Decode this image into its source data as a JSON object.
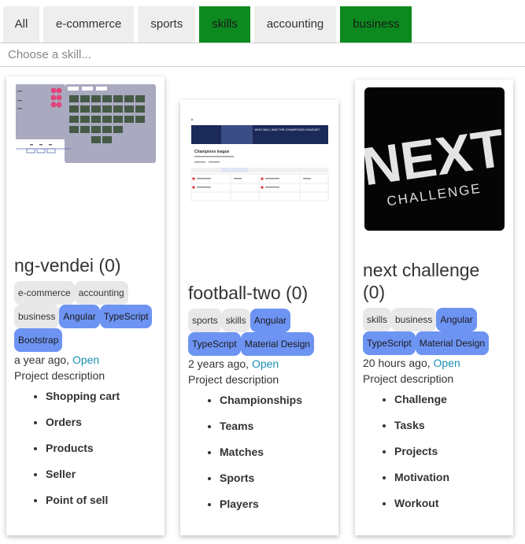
{
  "filters": [
    "All",
    "e-commerce",
    "sports",
    "skills",
    "accounting",
    "business"
  ],
  "search": {
    "placeholder": "Choose a skill..."
  },
  "cards": [
    {
      "title": "ng-vendei (0)",
      "tags": [
        "e-commerce",
        "accounting",
        "business"
      ],
      "tech": [
        "Angular",
        "TypeScript",
        "Bootstrap"
      ],
      "time": "a year ago, ",
      "open": "Open",
      "desc": "Project description",
      "features": [
        "Shopping cart",
        "Orders",
        "Products",
        "Seller",
        "Point of sell"
      ]
    },
    {
      "title": "football-two (0)",
      "tags": [
        "sports",
        "skills"
      ],
      "tech": [
        "Angular",
        "TypeScript",
        "Material Design"
      ],
      "time": "2 years ago, ",
      "open": "Open",
      "desc": "Project description",
      "features": [
        "Championships",
        "Teams",
        "Matches",
        "Sports",
        "Players"
      ],
      "thumb_text": {
        "banner": "WHO WILL WIN THE CHAMPIONS LEAGUE?",
        "heading": "Champions league"
      }
    },
    {
      "title": "next challenge (0)",
      "tags": [
        "skills",
        "business"
      ],
      "tech": [
        "Angular",
        "TypeScript",
        "Material Design"
      ],
      "time": "20 hours ago, ",
      "open": "Open",
      "desc": "Project description",
      "features": [
        "Challenge",
        "Tasks",
        "Projects",
        "Motivation",
        "Workout"
      ],
      "thumb_text": {
        "logo_top": "NEXT",
        "logo_bottom": "CHALLENGE"
      }
    }
  ]
}
